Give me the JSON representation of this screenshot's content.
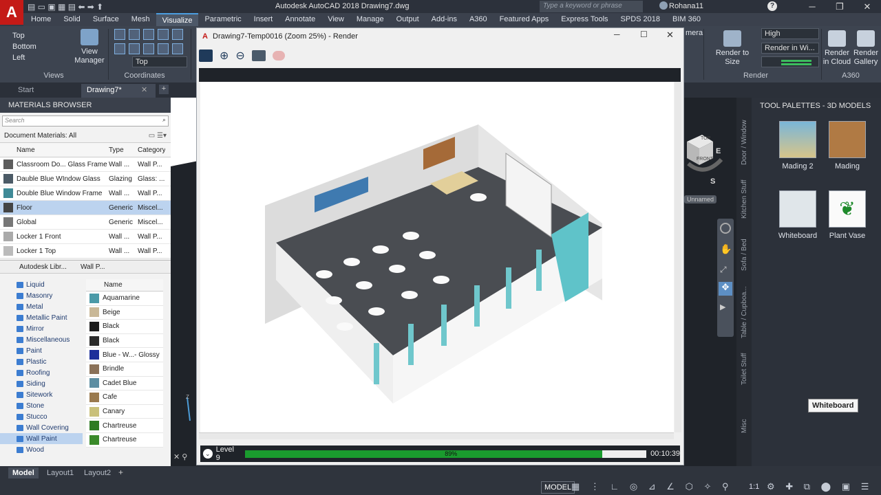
{
  "app": {
    "logo": "A",
    "title": "Autodesk AutoCAD 2018    Drawing7.dwg",
    "search_placeholder": "Type a keyword or phrase",
    "user": "Rohana11"
  },
  "ribbon_tabs": [
    "Home",
    "Solid",
    "Surface",
    "Mesh",
    "Visualize",
    "Parametric",
    "Insert",
    "Annotate",
    "View",
    "Manage",
    "Output",
    "Add-ins",
    "A360",
    "Featured Apps",
    "Express Tools",
    "SPDS 2018",
    "BIM 360"
  ],
  "ribbon": {
    "views": [
      "Top",
      "Bottom",
      "Left"
    ],
    "view_manager": "View\nManager",
    "views_label": "Views",
    "coordinates_label": "Coordinates",
    "coord_select": "Top",
    "quality_select": "High",
    "render_in_select": "Render in Wi...",
    "render_to_size": "Render to Size",
    "render_label": "Render",
    "render_in_cloud": "Render in Cloud",
    "render_gallery": "Render Gallery",
    "a360_label": "A360",
    "camera_partial": "mera"
  },
  "doc_tabs": [
    "Start",
    "Drawing7*"
  ],
  "materials_browser": {
    "title": "MATERIALS BROWSER",
    "search_placeholder": "Search",
    "filter": "Document Materials: All",
    "columns": [
      "Name",
      "Type",
      "Category"
    ],
    "rows": [
      {
        "name": "Classroom Do... Glass Frame",
        "type": "Wall ...",
        "category": "Wall P...",
        "color": "#5d5d5d"
      },
      {
        "name": "Dauble Blue WIndow Glass",
        "type": "Glazing",
        "category": "Glass: ...",
        "color": "#4b5a66"
      },
      {
        "name": "Double Blue Window Frame",
        "type": "Wall ...",
        "category": "Wall P...",
        "color": "#3f8a97"
      },
      {
        "name": "Floor",
        "type": "Generic",
        "category": "Miscel...",
        "color": "#444"
      },
      {
        "name": "Global",
        "type": "Generic",
        "category": "Miscel...",
        "color": "#777"
      },
      {
        "name": "Locker 1 Front",
        "type": "Wall ...",
        "category": "Wall P...",
        "color": "#aaa"
      },
      {
        "name": "Locker 1 Top",
        "type": "Wall ...",
        "category": "Wall P...",
        "color": "#bbb"
      }
    ],
    "library_path": [
      "Autodesk Libr...",
      "Wall P..."
    ],
    "tree": [
      "Liquid",
      "Masonry",
      "Metal",
      "Metallic Paint",
      "Mirror",
      "Miscellaneous",
      "Paint",
      "Plastic",
      "Roofing",
      "Siding",
      "Sitework",
      "Stone",
      "Stucco",
      "Wall Covering",
      "Wall Paint",
      "Wood"
    ],
    "lib_col": "Name",
    "swatches": [
      {
        "name": "Aquamarine",
        "color": "#4b9aa8"
      },
      {
        "name": "Beige",
        "color": "#c9b897"
      },
      {
        "name": "Black",
        "color": "#1d1d1d"
      },
      {
        "name": "Black",
        "color": "#2a2a2a"
      },
      {
        "name": "Blue - W...- Glossy",
        "color": "#1d2f9a"
      },
      {
        "name": "Brindle",
        "color": "#8a7158"
      },
      {
        "name": "Cadet Blue",
        "color": "#5d8ea2"
      },
      {
        "name": "Cafe",
        "color": "#9a7a4e"
      },
      {
        "name": "Canary",
        "color": "#c9c07a"
      },
      {
        "name": "Chartreuse",
        "color": "#2e7b23"
      },
      {
        "name": "Chartreuse",
        "color": "#3a8a2a"
      }
    ]
  },
  "render_window": {
    "title": "Drawing7-Temp0016 (Zoom 25%) - Render",
    "level": "Level 9",
    "progress_text": "89%",
    "progress": 0.89,
    "elapsed": "00:10:39"
  },
  "viewport": {
    "named": "Unnamed",
    "cube_top": "TOP",
    "cube_front": "FRONT",
    "compass_e": "E",
    "compass_s": "S"
  },
  "tool_palettes": {
    "title": "TOOL PALETTES - 3D MODELS",
    "items": [
      "Mading 2",
      "Mading",
      "Whiteboard",
      "Plant Vase"
    ],
    "tabs": [
      "Door / Window",
      "Kitchen Stuff",
      "Sofa / Bed",
      "Table / Cupboa...",
      "Toilet Stuff",
      "Misc"
    ],
    "tooltip": "Whiteboard"
  },
  "bottom_tabs": [
    "Model",
    "Layout1",
    "Layout2"
  ],
  "status": {
    "model": "MODEL",
    "scale": "1:1"
  }
}
